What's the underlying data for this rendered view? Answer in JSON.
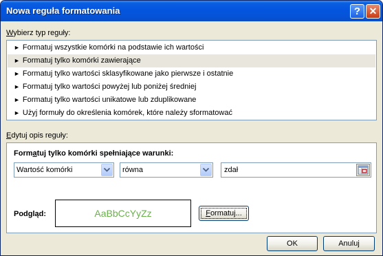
{
  "window": {
    "title": "Nowa reguła formatowania",
    "help_glyph": "?",
    "close_glyph": "✕"
  },
  "rule_type": {
    "label_accel": "W",
    "label_rest": "ybierz typ reguły:",
    "items": [
      {
        "label": "Formatuj wszystkie komórki na podstawie ich wartości",
        "selected": false
      },
      {
        "label": "Formatuj tylko komórki zawierające",
        "selected": true
      },
      {
        "label": "Formatuj tylko wartości sklasyfikowane jako pierwsze i ostatnie",
        "selected": false
      },
      {
        "label": "Formatuj tylko wartości powyżej lub poniżej średniej",
        "selected": false
      },
      {
        "label": "Formatuj tylko wartości unikatowe lub zduplikowane",
        "selected": false
      },
      {
        "label": "Użyj formuły do określenia komórek, które należy sformatować",
        "selected": false
      }
    ],
    "arrow_glyph": "►"
  },
  "rule_description": {
    "label_accel": "E",
    "label_rest": "dytuj opis reguły:",
    "heading_pre": "Form",
    "heading_accel": "a",
    "heading_post": "tuj tylko komórki spełniające warunki:",
    "condition_field": "Wartość komórki",
    "operator": "równa",
    "value": "zdał",
    "preview_label": "Podgląd:",
    "preview_sample": "AaBbCcYyZz",
    "preview_color": "#6ab04c",
    "format_button_accel": "F",
    "format_button_rest": "ormatuj..."
  },
  "buttons": {
    "ok": "OK",
    "cancel": "Anuluj"
  }
}
